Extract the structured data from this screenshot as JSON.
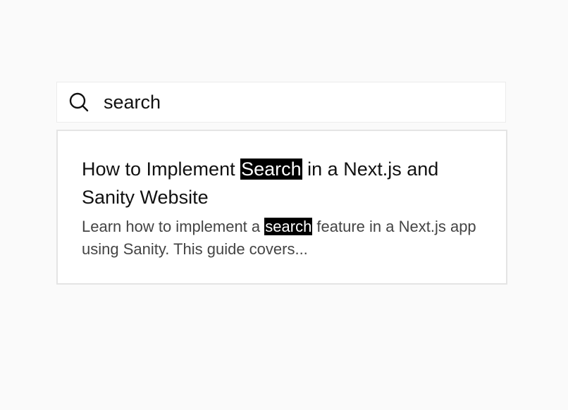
{
  "search": {
    "value": "search",
    "icon": "search-icon"
  },
  "results": [
    {
      "title_before": "How to Implement ",
      "title_match": "Search",
      "title_after": " in a Next.js and Sanity Website",
      "snippet_before": "Learn how to implement a ",
      "snippet_match": "search",
      "snippet_after": " feature in a Next.js app using Sanity. This guide covers..."
    }
  ],
  "colors": {
    "highlight_bg": "#000000",
    "highlight_text": "#ffffff",
    "page_bg": "#fafafa"
  }
}
